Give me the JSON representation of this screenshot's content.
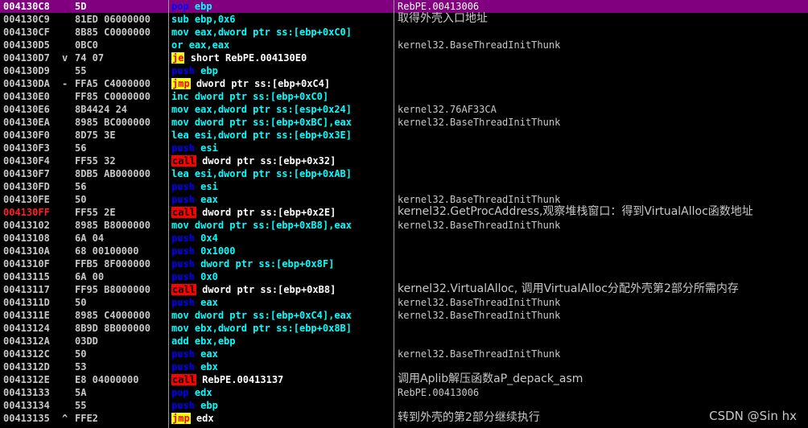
{
  "watermark": "CSDN @Sin hx",
  "rows": [
    {
      "addr": "004130C8",
      "mark": "",
      "hex": "5D",
      "mn": "pop",
      "op": "ebp",
      "cmt": "RebPE.00413006",
      "sel": true,
      "bp": false
    },
    {
      "addr": "004130C9",
      "mark": "",
      "hex": "81ED 06000000",
      "mn": "sub",
      "op": "ebp,0x6",
      "cmt": "取得外壳入口地址",
      "sel": false,
      "bp": false
    },
    {
      "addr": "004130CF",
      "mark": "",
      "hex": "8B85 C0000000",
      "mn": "mov",
      "op": "eax,dword ptr ss:[ebp+0xC0]",
      "cmt": "",
      "sel": false,
      "bp": false
    },
    {
      "addr": "004130D5",
      "mark": "",
      "hex": "0BC0",
      "mn": "or",
      "op": "eax,eax",
      "cmt": "kernel32.BaseThreadInitThunk",
      "sel": false,
      "bp": false
    },
    {
      "addr": "004130D7",
      "mark": "v",
      "hex": "74 07",
      "mn": "je",
      "op": "short RebPE.004130E0",
      "cmt": "",
      "sel": false,
      "bp": false
    },
    {
      "addr": "004130D9",
      "mark": "",
      "hex": "55",
      "mn": "push",
      "op": "ebp",
      "cmt": "",
      "sel": false,
      "bp": false
    },
    {
      "addr": "004130DA",
      "mark": "-",
      "hex": "FFA5 C4000000",
      "mn": "jmp",
      "op": "dword ptr ss:[ebp+0xC4]",
      "cmt": "",
      "sel": false,
      "bp": false
    },
    {
      "addr": "004130E0",
      "mark": "",
      "hex": "FF85 C0000000",
      "mn": "inc",
      "op": "dword ptr ss:[ebp+0xC0]",
      "cmt": "",
      "sel": false,
      "bp": false
    },
    {
      "addr": "004130E6",
      "mark": "",
      "hex": "8B4424 24",
      "mn": "mov",
      "op": "eax,dword ptr ss:[esp+0x24]",
      "cmt": "kernel32.76AF33CA",
      "sel": false,
      "bp": false
    },
    {
      "addr": "004130EA",
      "mark": "",
      "hex": "8985 BC000000",
      "mn": "mov",
      "op": "dword ptr ss:[ebp+0xBC],eax",
      "cmt": "kernel32.BaseThreadInitThunk",
      "sel": false,
      "bp": false
    },
    {
      "addr": "004130F0",
      "mark": "",
      "hex": "8D75 3E",
      "mn": "lea",
      "op": "esi,dword ptr ss:[ebp+0x3E]",
      "cmt": "",
      "sel": false,
      "bp": false
    },
    {
      "addr": "004130F3",
      "mark": "",
      "hex": "56",
      "mn": "push",
      "op": "esi",
      "cmt": "",
      "sel": false,
      "bp": false
    },
    {
      "addr": "004130F4",
      "mark": "",
      "hex": "FF55 32",
      "mn": "call",
      "op": "dword ptr ss:[ebp+0x32]",
      "cmt": "",
      "sel": false,
      "bp": false
    },
    {
      "addr": "004130F7",
      "mark": "",
      "hex": "8DB5 AB000000",
      "mn": "lea",
      "op": "esi,dword ptr ss:[ebp+0xAB]",
      "cmt": "",
      "sel": false,
      "bp": false
    },
    {
      "addr": "004130FD",
      "mark": "",
      "hex": "56",
      "mn": "push",
      "op": "esi",
      "cmt": "",
      "sel": false,
      "bp": false
    },
    {
      "addr": "004130FE",
      "mark": "",
      "hex": "50",
      "mn": "push",
      "op": "eax",
      "cmt": "kernel32.BaseThreadInitThunk",
      "sel": false,
      "bp": false
    },
    {
      "addr": "004130FF",
      "mark": "",
      "hex": "FF55 2E",
      "mn": "call",
      "op": "dword ptr ss:[ebp+0x2E]",
      "cmt": "kernel32.GetProcAddress,观察堆栈窗口：得到VirtualAlloc函数地址",
      "sel": false,
      "bp": true
    },
    {
      "addr": "00413102",
      "mark": "",
      "hex": "8985 B8000000",
      "mn": "mov",
      "op": "dword ptr ss:[ebp+0xB8],eax",
      "cmt": "kernel32.BaseThreadInitThunk",
      "sel": false,
      "bp": false
    },
    {
      "addr": "00413108",
      "mark": "",
      "hex": "6A 04",
      "mn": "push",
      "op": "0x4",
      "cmt": "",
      "sel": false,
      "bp": false
    },
    {
      "addr": "0041310A",
      "mark": "",
      "hex": "68 00100000",
      "mn": "push",
      "op": "0x1000",
      "cmt": "",
      "sel": false,
      "bp": false
    },
    {
      "addr": "0041310F",
      "mark": "",
      "hex": "FFB5 8F000000",
      "mn": "push",
      "op": "dword ptr ss:[ebp+0x8F]",
      "cmt": "",
      "sel": false,
      "bp": false
    },
    {
      "addr": "00413115",
      "mark": "",
      "hex": "6A 00",
      "mn": "push",
      "op": "0x0",
      "cmt": "",
      "sel": false,
      "bp": false
    },
    {
      "addr": "00413117",
      "mark": "",
      "hex": "FF95 B8000000",
      "mn": "call",
      "op": "dword ptr ss:[ebp+0xB8]",
      "cmt": "kernel32.VirtualAlloc, 调用VirtualAlloc分配外壳第2部分所需内存",
      "sel": false,
      "bp": false
    },
    {
      "addr": "0041311D",
      "mark": "",
      "hex": "50",
      "mn": "push",
      "op": "eax",
      "cmt": "kernel32.BaseThreadInitThunk",
      "sel": false,
      "bp": false
    },
    {
      "addr": "0041311E",
      "mark": "",
      "hex": "8985 C4000000",
      "mn": "mov",
      "op": "dword ptr ss:[ebp+0xC4],eax",
      "cmt": "kernel32.BaseThreadInitThunk",
      "sel": false,
      "bp": false
    },
    {
      "addr": "00413124",
      "mark": "",
      "hex": "8B9D 8B000000",
      "mn": "mov",
      "op": "ebx,dword ptr ss:[ebp+0x8B]",
      "cmt": "",
      "sel": false,
      "bp": false
    },
    {
      "addr": "0041312A",
      "mark": "",
      "hex": "03DD",
      "mn": "add",
      "op": "ebx,ebp",
      "cmt": "",
      "sel": false,
      "bp": false
    },
    {
      "addr": "0041312C",
      "mark": "",
      "hex": "50",
      "mn": "push",
      "op": "eax",
      "cmt": "kernel32.BaseThreadInitThunk",
      "sel": false,
      "bp": false
    },
    {
      "addr": "0041312D",
      "mark": "",
      "hex": "53",
      "mn": "push",
      "op": "ebx",
      "cmt": "",
      "sel": false,
      "bp": false
    },
    {
      "addr": "0041312E",
      "mark": "",
      "hex": "E8 04000000",
      "mn": "call",
      "op": "RebPE.00413137",
      "cmt": "调用Aplib解压函数aP_depack_asm",
      "sel": false,
      "bp": false
    },
    {
      "addr": "00413133",
      "mark": "",
      "hex": "5A",
      "mn": "pop",
      "op": "edx",
      "cmt": "RebPE.00413006",
      "sel": false,
      "bp": false
    },
    {
      "addr": "00413134",
      "mark": "",
      "hex": "55",
      "mn": "push",
      "op": "ebp",
      "cmt": "",
      "sel": false,
      "bp": false
    },
    {
      "addr": "00413135",
      "mark": "^",
      "hex": "FFE2",
      "mn": "jmp",
      "op": "edx",
      "cmt": "转到外壳的第2部分继续执行",
      "sel": false,
      "bp": false
    }
  ]
}
